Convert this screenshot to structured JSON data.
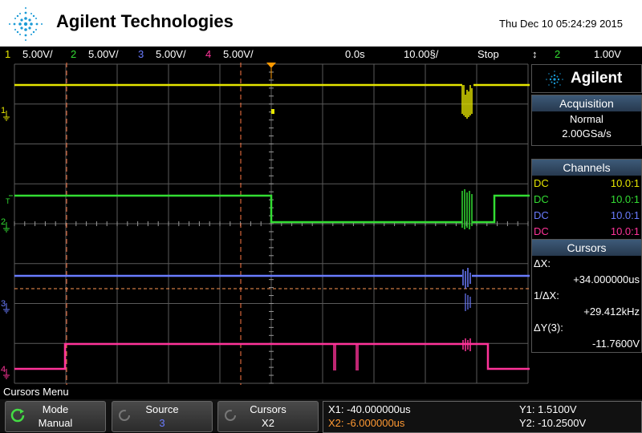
{
  "header": {
    "brand": "Agilent Technologies",
    "datetime": "Thu Dec 10 05:24:29 2015"
  },
  "status": {
    "ch1": {
      "num": "1",
      "scale": "5.00V/",
      "color": "#e6e600"
    },
    "ch2": {
      "num": "2",
      "scale": "5.00V/",
      "color": "#33dd33"
    },
    "ch3": {
      "num": "3",
      "scale": "5.00V/",
      "color": "#6a7cff"
    },
    "ch4": {
      "num": "4",
      "scale": "5.00V/",
      "color": "#ff3399"
    },
    "delay": "0.0s",
    "timebase": "10.00§/",
    "run_state": "Stop",
    "trigger_symbol": "↕",
    "trigger_channel": "2",
    "trigger_level": "1.00V"
  },
  "channel_markers": {
    "ch1": "1",
    "ch2": "2",
    "ch3": "3",
    "ch4": "4",
    "trig_t": "T"
  },
  "side": {
    "logo": "Agilent",
    "acquisition": {
      "title": "Acquisition",
      "mode": "Normal",
      "rate": "2.00GSa/s"
    },
    "channels": {
      "title": "Channels",
      "rows": [
        {
          "coupling": "DC",
          "probe": "10.0:1",
          "color": "#e6e600"
        },
        {
          "coupling": "DC",
          "probe": "10.0:1",
          "color": "#33dd33"
        },
        {
          "coupling": "DC",
          "probe": "10.0:1",
          "color": "#6a7cff"
        },
        {
          "coupling": "DC",
          "probe": "10.0:1",
          "color": "#ff3399"
        }
      ]
    },
    "cursors": {
      "title": "Cursors",
      "dx_label": "ΔX:",
      "dx_value": "+34.000000us",
      "inv_label": "1/ΔX:",
      "inv_value": "+29.412kHz",
      "dy_label": "ΔY(3):",
      "dy_value": "-11.7600V"
    }
  },
  "menu": {
    "title": "Cursors Menu",
    "mode_label": "Mode",
    "mode_value": "Manual",
    "source_label": "Source",
    "source_value": "3",
    "cursors_label": "Cursors",
    "cursors_value": "X2"
  },
  "readout": {
    "x1": "X1: -40.000000us",
    "x2": "X2: -6.000000us",
    "y1": "Y1: 1.5100V",
    "y2": "Y2: -10.2500V"
  }
}
